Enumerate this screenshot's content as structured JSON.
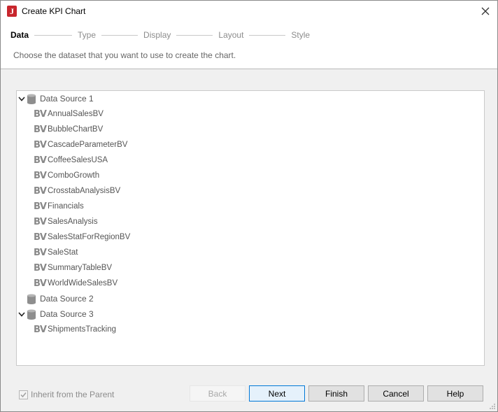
{
  "window": {
    "title": "Create KPI Chart"
  },
  "wizard": {
    "steps": [
      {
        "label": "Data",
        "active": true
      },
      {
        "label": "Type",
        "active": false
      },
      {
        "label": "Display",
        "active": false
      },
      {
        "label": "Layout",
        "active": false
      },
      {
        "label": "Style",
        "active": false
      }
    ],
    "instruction": "Choose the dataset that you want to use to create the chart."
  },
  "tree": {
    "bv_badge": "BV",
    "sources": [
      {
        "label": "Data Source 1",
        "expanded": true,
        "items": [
          "AnnualSalesBV",
          "BubbleChartBV",
          "CascadeParameterBV",
          "CoffeeSalesUSA",
          "ComboGrowth",
          "CrosstabAnalysisBV",
          "Financials",
          "SalesAnalysis",
          "SalesStatForRegionBV",
          "SaleStat",
          "SummaryTableBV",
          "WorldWideSalesBV"
        ]
      },
      {
        "label": "Data Source 2",
        "expanded": false,
        "items": []
      },
      {
        "label": "Data Source 3",
        "expanded": true,
        "items": [
          "ShipmentsTracking"
        ]
      }
    ]
  },
  "footer": {
    "inherit_label": "Inherit from the Parent",
    "inherit_checked": true,
    "buttons": {
      "back": "Back",
      "next": "Next",
      "finish": "Finish",
      "cancel": "Cancel",
      "help": "Help"
    }
  },
  "colors": {
    "accent": "#0078d7",
    "app_icon": "#c8262d"
  },
  "icons": {
    "app": "app-logo-icon",
    "close": "close-icon",
    "expand": "chevron-down-icon",
    "source": "database-icon",
    "view": "business-view-icon",
    "check": "checkmark-icon",
    "resize": "resize-grip-icon"
  }
}
